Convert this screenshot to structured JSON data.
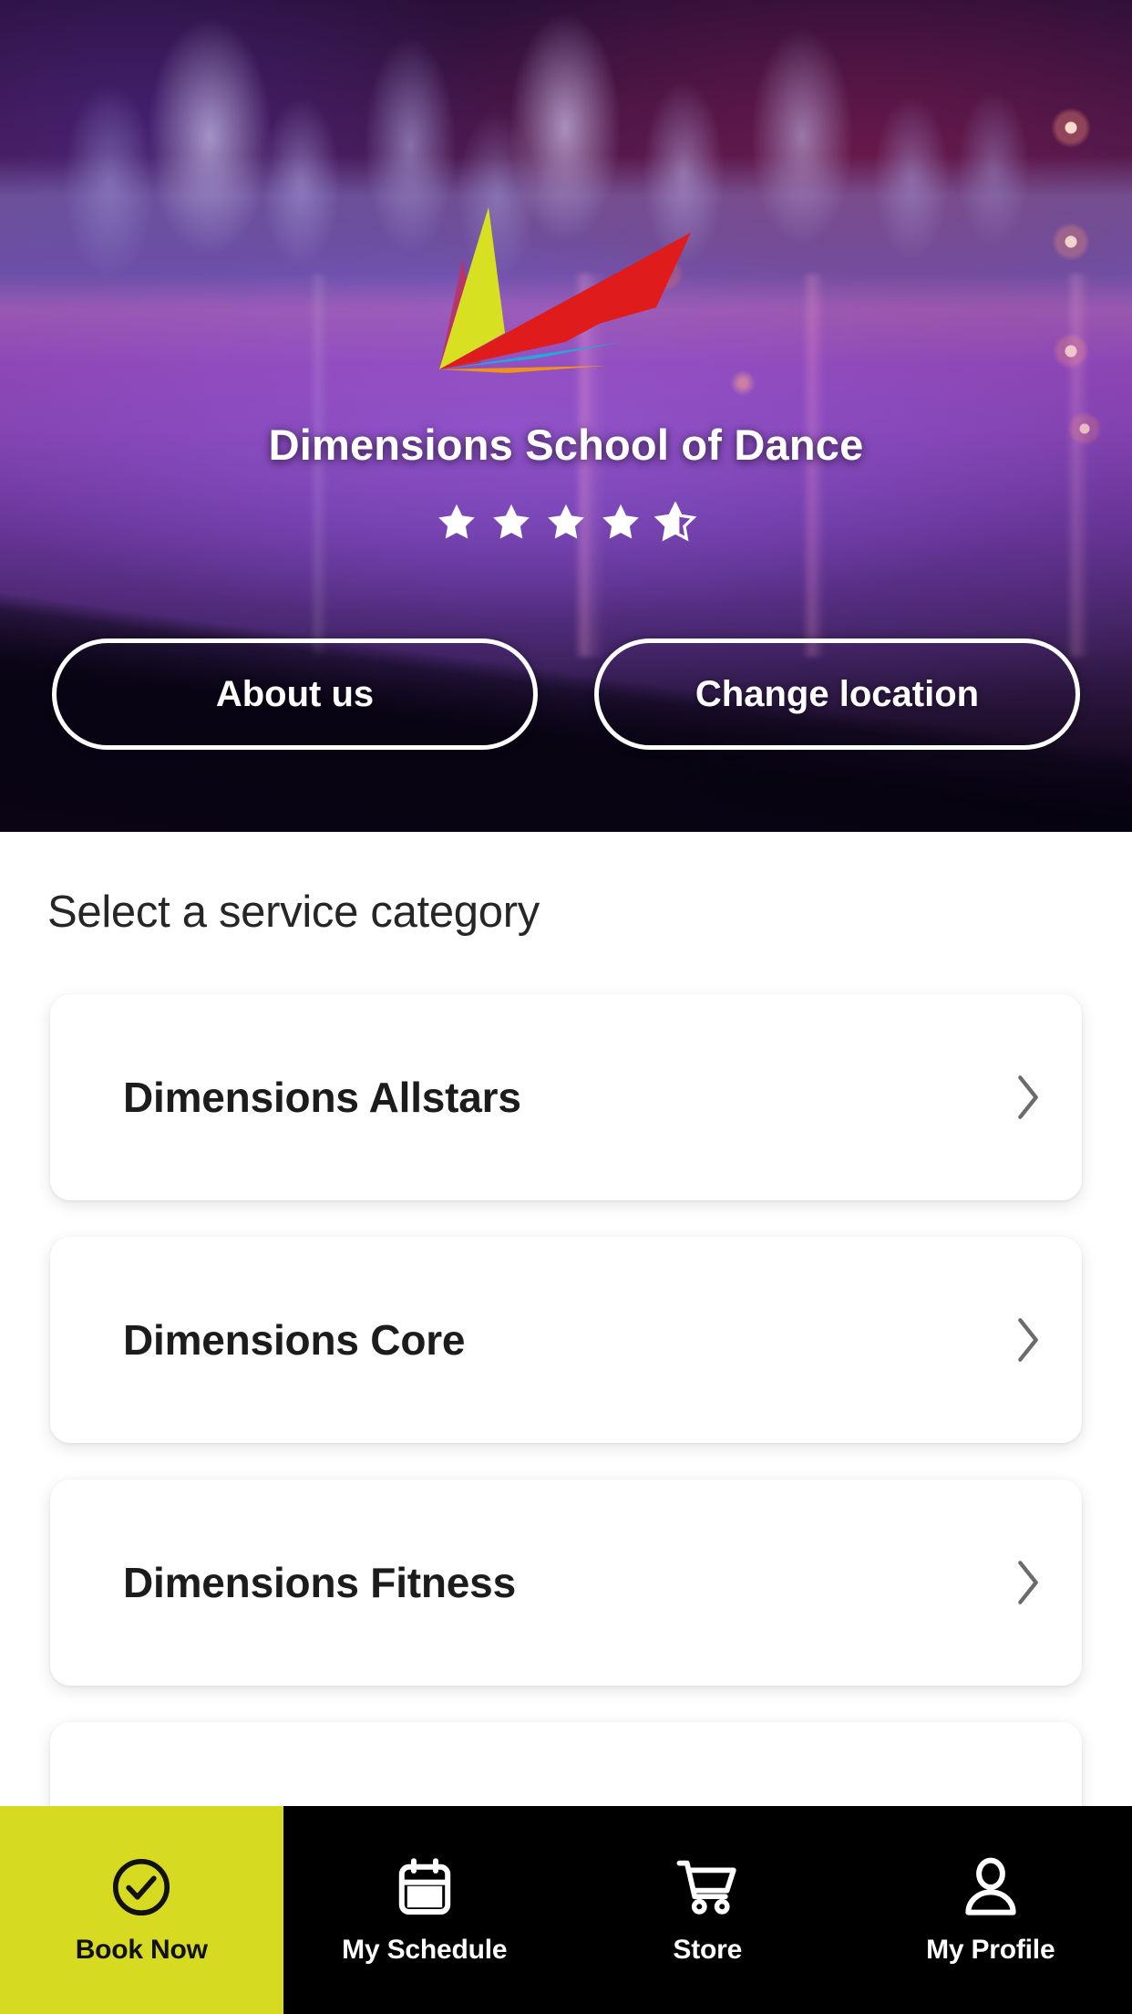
{
  "hero": {
    "title": "Dimensions School of Dance",
    "logo": {
      "name": "dimensions-burst-logo",
      "colors": [
        "#e01b1b",
        "#d7e021",
        "#2aa5d8",
        "#f0901d",
        "#b8356b"
      ]
    },
    "rating": {
      "value": 4.6,
      "max": 5,
      "full_stars": 4,
      "partial_fraction": 0.6,
      "star_color": "#ffffff"
    },
    "buttons": [
      {
        "label": "About us",
        "name": "about-us-button"
      },
      {
        "label": "Change location",
        "name": "change-location-button"
      }
    ]
  },
  "main": {
    "heading": "Select a service category",
    "categories": [
      {
        "label": "Dimensions Allstars"
      },
      {
        "label": "Dimensions Core"
      },
      {
        "label": "Dimensions Fitness"
      }
    ]
  },
  "bottom_nav": {
    "active_index": 0,
    "accent_color": "#d6da21",
    "background_color": "#000000",
    "items": [
      {
        "label": "Book Now",
        "icon": "check-circle-icon"
      },
      {
        "label": "My Schedule",
        "icon": "calendar-icon"
      },
      {
        "label": "Store",
        "icon": "shopping-cart-icon"
      },
      {
        "label": "My Profile",
        "icon": "person-icon"
      }
    ]
  }
}
